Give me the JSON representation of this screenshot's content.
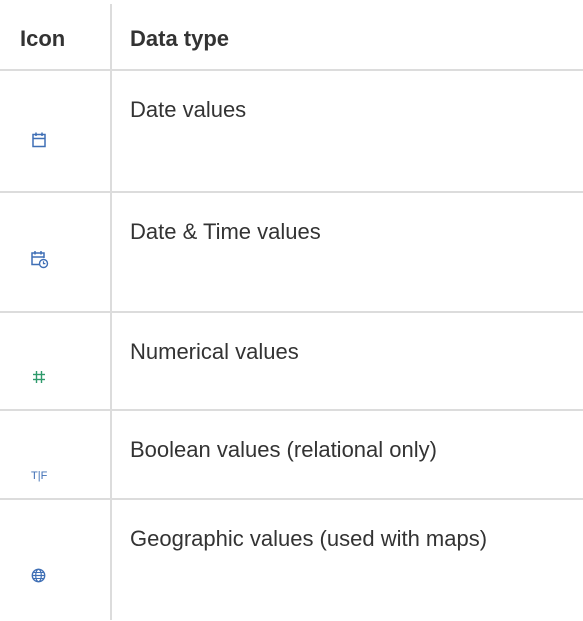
{
  "table": {
    "headers": {
      "icon": "Icon",
      "data_type": "Data type"
    },
    "rows": [
      {
        "icon_name": "calendar-icon",
        "label": "Date values"
      },
      {
        "icon_name": "calendar-clock-icon",
        "label": "Date & Time values"
      },
      {
        "icon_name": "hash-icon",
        "label": "Numerical values"
      },
      {
        "icon_name": "boolean-tf-icon",
        "icon_text": "T|F",
        "label": "Boolean values (relational only)"
      },
      {
        "icon_name": "globe-icon",
        "label": "Geographic values (used with maps)"
      }
    ]
  },
  "colors": {
    "date_icon": "#3f6fb5",
    "number_icon": "#2e9a6b",
    "text": "#333333",
    "divider": "#dcdcdc"
  }
}
